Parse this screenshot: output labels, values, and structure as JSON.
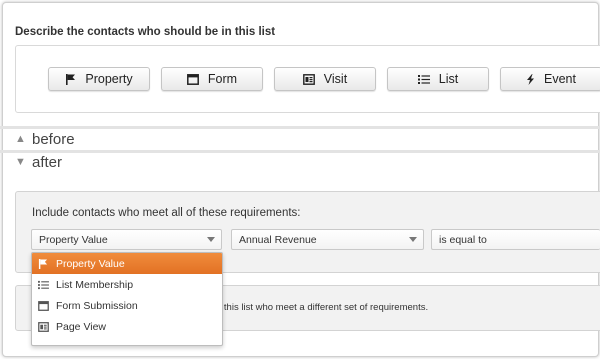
{
  "header": {
    "title": "Describe the contacts who should be in this list"
  },
  "filter_types": [
    {
      "label": "Property",
      "icon": "flag-icon"
    },
    {
      "label": "Form",
      "icon": "form-icon"
    },
    {
      "label": "Visit",
      "icon": "page-icon"
    },
    {
      "label": "List",
      "icon": "list-icon"
    },
    {
      "label": "Event",
      "icon": "lightning-icon"
    }
  ],
  "sections": {
    "before": {
      "label": "before",
      "state": "collapsed"
    },
    "after": {
      "label": "after",
      "state": "expanded"
    }
  },
  "after_panel": {
    "requirement_text": "Include contacts who meet all of these requirements:",
    "filter_select": "Property Value",
    "property_select": "Annual Revenue",
    "operator_select": "is equal to"
  },
  "second_panel": {
    "text": "o this list who meet a different set of requirements."
  },
  "dropdown": {
    "items": [
      {
        "label": "Property Value",
        "icon": "flag-icon",
        "selected": true
      },
      {
        "label": "List Membership",
        "icon": "list-icon",
        "selected": false
      },
      {
        "label": "Form Submission",
        "icon": "form-icon",
        "selected": false
      },
      {
        "label": "Page View",
        "icon": "page-icon",
        "selected": false
      }
    ]
  },
  "colors": {
    "accent": "#e8792c",
    "panel": "#f2f2f2"
  }
}
